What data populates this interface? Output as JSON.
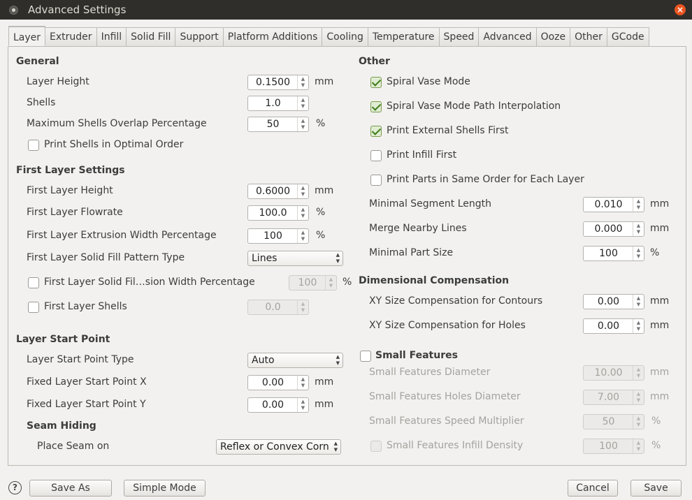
{
  "window": {
    "title": "Advanced Settings"
  },
  "tabs": [
    "Layer",
    "Extruder",
    "Infill",
    "Solid Fill",
    "Support",
    "Platform Additions",
    "Cooling",
    "Temperature",
    "Speed",
    "Advanced",
    "Ooze",
    "Other",
    "GCode"
  ],
  "general": {
    "title": "General",
    "layer_height": {
      "label": "Layer Height",
      "value": "0.1500",
      "unit": "mm"
    },
    "shells": {
      "label": "Shells",
      "value": "1.0"
    },
    "max_shells_overlap": {
      "label": "Maximum Shells Overlap Percentage",
      "value": "50",
      "unit": "%"
    },
    "print_shells_optimal": {
      "label": "Print Shells in Optimal Order",
      "checked": false
    }
  },
  "first_layer": {
    "title": "First Layer Settings",
    "height": {
      "label": "First Layer Height",
      "value": "0.6000",
      "unit": "mm"
    },
    "flowrate": {
      "label": "First Layer Flowrate",
      "value": "100.0",
      "unit": "%"
    },
    "extrusion_width": {
      "label": "First Layer Extrusion Width Percentage",
      "value": "100",
      "unit": "%"
    },
    "fill_pattern": {
      "label": "First Layer Solid Fill Pattern Type",
      "value": "Lines"
    },
    "solid_fill_width": {
      "label": "First Layer Solid Fil…sion Width Percentage",
      "value": "100",
      "unit": "%",
      "checked": false
    },
    "shells": {
      "label": "First Layer Shells",
      "value": "0.0",
      "checked": false
    }
  },
  "start_point": {
    "title": "Layer Start Point",
    "type": {
      "label": "Layer Start Point Type",
      "value": "Auto"
    },
    "x": {
      "label": "Fixed Layer Start Point X",
      "value": "0.00",
      "unit": "mm"
    },
    "y": {
      "label": "Fixed Layer Start Point Y",
      "value": "0.00",
      "unit": "mm"
    },
    "seam_title": "Seam Hiding",
    "seam": {
      "label": "Place Seam on",
      "value": "Reflex or Convex Corne"
    }
  },
  "other": {
    "title": "Other",
    "spiral_vase": {
      "label": "Spiral Vase Mode",
      "checked": true
    },
    "spiral_interp": {
      "label": "Spiral Vase Mode Path Interpolation",
      "checked": true
    },
    "ext_shells_first": {
      "label": "Print External Shells First",
      "checked": true
    },
    "infill_first": {
      "label": "Print Infill First",
      "checked": false
    },
    "same_order": {
      "label": "Print Parts in Same Order for Each Layer",
      "checked": false
    },
    "min_segment": {
      "label": "Minimal Segment Length",
      "value": "0.010",
      "unit": "mm"
    },
    "merge_lines": {
      "label": "Merge Nearby Lines",
      "value": "0.000",
      "unit": "mm"
    },
    "min_part": {
      "label": "Minimal Part Size",
      "value": "100",
      "unit": "%"
    }
  },
  "dimensional": {
    "title": "Dimensional Compensation",
    "contours": {
      "label": "XY Size Compensation for Contours",
      "value": "0.00",
      "unit": "mm"
    },
    "holes": {
      "label": "XY Size Compensation for Holes",
      "value": "0.00",
      "unit": "mm"
    }
  },
  "small_features": {
    "title": "Small Features",
    "checked": false,
    "diameter": {
      "label": "Small Features Diameter",
      "value": "10.00",
      "unit": "mm"
    },
    "holes_diameter": {
      "label": "Small Features Holes Diameter",
      "value": "7.00",
      "unit": "mm"
    },
    "speed_mult": {
      "label": "Small Features Speed Multiplier",
      "value": "50",
      "unit": "%"
    },
    "infill_density": {
      "label": "Small Features Infill Density",
      "value": "100",
      "unit": "%"
    }
  },
  "footer": {
    "help": "?",
    "save_as": "Save As",
    "simple_mode": "Simple Mode",
    "cancel": "Cancel",
    "save": "Save"
  },
  "colors": {
    "accent": "#e95420",
    "titlebar": "#2f2e2b",
    "check": "#3f7c1b"
  }
}
